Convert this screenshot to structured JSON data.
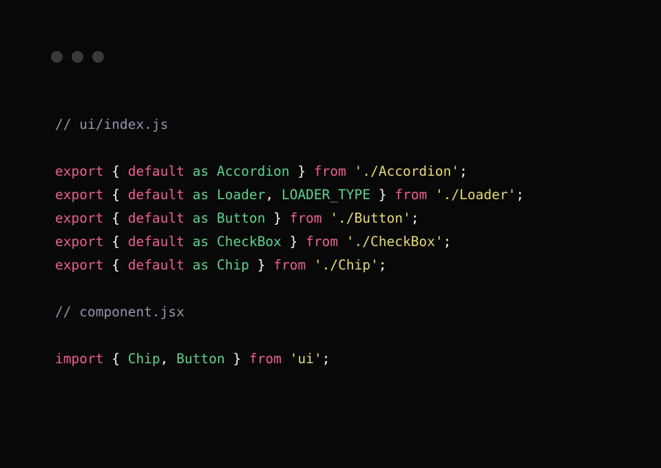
{
  "window": {
    "background_color": "#080808",
    "controls": [
      {
        "name": "window-dot-close",
        "color": "#3a3a3a"
      },
      {
        "name": "window-dot-minimize",
        "color": "#3a3a3a"
      },
      {
        "name": "window-dot-maximize",
        "color": "#3a3a3a"
      }
    ]
  },
  "theme": {
    "comment_color": "#9a92b0",
    "keyword_color": "#ef5f96",
    "identifier_color": "#5fd38d",
    "string_color": "#e6db74",
    "punctuation_color": "#f8f8f2"
  },
  "code": {
    "language": "javascript",
    "lines": [
      {
        "type": "comment",
        "text": "// ui/index.js"
      },
      {
        "type": "blank",
        "text": ""
      },
      {
        "type": "code",
        "tokens": [
          {
            "kind": "keyword",
            "text": "export"
          },
          {
            "kind": "plain",
            "text": " "
          },
          {
            "kind": "punct",
            "text": "{"
          },
          {
            "kind": "plain",
            "text": " "
          },
          {
            "kind": "keyword",
            "text": "default"
          },
          {
            "kind": "plain",
            "text": " "
          },
          {
            "kind": "name",
            "text": "as"
          },
          {
            "kind": "plain",
            "text": " "
          },
          {
            "kind": "name",
            "text": "Accordion"
          },
          {
            "kind": "plain",
            "text": " "
          },
          {
            "kind": "punct",
            "text": "}"
          },
          {
            "kind": "plain",
            "text": " "
          },
          {
            "kind": "keyword",
            "text": "from"
          },
          {
            "kind": "plain",
            "text": " "
          },
          {
            "kind": "string",
            "text": "'./Accordion'"
          },
          {
            "kind": "punct",
            "text": ";"
          }
        ]
      },
      {
        "type": "code",
        "tokens": [
          {
            "kind": "keyword",
            "text": "export"
          },
          {
            "kind": "plain",
            "text": " "
          },
          {
            "kind": "punct",
            "text": "{"
          },
          {
            "kind": "plain",
            "text": " "
          },
          {
            "kind": "keyword",
            "text": "default"
          },
          {
            "kind": "plain",
            "text": " "
          },
          {
            "kind": "name",
            "text": "as"
          },
          {
            "kind": "plain",
            "text": " "
          },
          {
            "kind": "name",
            "text": "Loader"
          },
          {
            "kind": "punct",
            "text": ","
          },
          {
            "kind": "plain",
            "text": " "
          },
          {
            "kind": "name",
            "text": "LOADER_TYPE"
          },
          {
            "kind": "plain",
            "text": " "
          },
          {
            "kind": "punct",
            "text": "}"
          },
          {
            "kind": "plain",
            "text": " "
          },
          {
            "kind": "keyword",
            "text": "from"
          },
          {
            "kind": "plain",
            "text": " "
          },
          {
            "kind": "string",
            "text": "'./Loader'"
          },
          {
            "kind": "punct",
            "text": ";"
          }
        ]
      },
      {
        "type": "code",
        "tokens": [
          {
            "kind": "keyword",
            "text": "export"
          },
          {
            "kind": "plain",
            "text": " "
          },
          {
            "kind": "punct",
            "text": "{"
          },
          {
            "kind": "plain",
            "text": " "
          },
          {
            "kind": "keyword",
            "text": "default"
          },
          {
            "kind": "plain",
            "text": " "
          },
          {
            "kind": "name",
            "text": "as"
          },
          {
            "kind": "plain",
            "text": " "
          },
          {
            "kind": "name",
            "text": "Button"
          },
          {
            "kind": "plain",
            "text": " "
          },
          {
            "kind": "punct",
            "text": "}"
          },
          {
            "kind": "plain",
            "text": " "
          },
          {
            "kind": "keyword",
            "text": "from"
          },
          {
            "kind": "plain",
            "text": " "
          },
          {
            "kind": "string",
            "text": "'./Button'"
          },
          {
            "kind": "punct",
            "text": ";"
          }
        ]
      },
      {
        "type": "code",
        "tokens": [
          {
            "kind": "keyword",
            "text": "export"
          },
          {
            "kind": "plain",
            "text": " "
          },
          {
            "kind": "punct",
            "text": "{"
          },
          {
            "kind": "plain",
            "text": " "
          },
          {
            "kind": "keyword",
            "text": "default"
          },
          {
            "kind": "plain",
            "text": " "
          },
          {
            "kind": "name",
            "text": "as"
          },
          {
            "kind": "plain",
            "text": " "
          },
          {
            "kind": "name",
            "text": "CheckBox"
          },
          {
            "kind": "plain",
            "text": " "
          },
          {
            "kind": "punct",
            "text": "}"
          },
          {
            "kind": "plain",
            "text": " "
          },
          {
            "kind": "keyword",
            "text": "from"
          },
          {
            "kind": "plain",
            "text": " "
          },
          {
            "kind": "string",
            "text": "'./CheckBox'"
          },
          {
            "kind": "punct",
            "text": ";"
          }
        ]
      },
      {
        "type": "code",
        "tokens": [
          {
            "kind": "keyword",
            "text": "export"
          },
          {
            "kind": "plain",
            "text": " "
          },
          {
            "kind": "punct",
            "text": "{"
          },
          {
            "kind": "plain",
            "text": " "
          },
          {
            "kind": "keyword",
            "text": "default"
          },
          {
            "kind": "plain",
            "text": " "
          },
          {
            "kind": "name",
            "text": "as"
          },
          {
            "kind": "plain",
            "text": " "
          },
          {
            "kind": "name",
            "text": "Chip"
          },
          {
            "kind": "plain",
            "text": " "
          },
          {
            "kind": "punct",
            "text": "}"
          },
          {
            "kind": "plain",
            "text": " "
          },
          {
            "kind": "keyword",
            "text": "from"
          },
          {
            "kind": "plain",
            "text": " "
          },
          {
            "kind": "string",
            "text": "'./Chip'"
          },
          {
            "kind": "punct",
            "text": ";"
          }
        ]
      },
      {
        "type": "blank",
        "text": ""
      },
      {
        "type": "comment",
        "text": "// component.jsx"
      },
      {
        "type": "blank",
        "text": ""
      },
      {
        "type": "code",
        "tokens": [
          {
            "kind": "keyword",
            "text": "import"
          },
          {
            "kind": "plain",
            "text": " "
          },
          {
            "kind": "punct",
            "text": "{"
          },
          {
            "kind": "plain",
            "text": " "
          },
          {
            "kind": "name",
            "text": "Chip"
          },
          {
            "kind": "punct",
            "text": ","
          },
          {
            "kind": "plain",
            "text": " "
          },
          {
            "kind": "name",
            "text": "Button"
          },
          {
            "kind": "plain",
            "text": " "
          },
          {
            "kind": "punct",
            "text": "}"
          },
          {
            "kind": "plain",
            "text": " "
          },
          {
            "kind": "keyword",
            "text": "from"
          },
          {
            "kind": "plain",
            "text": " "
          },
          {
            "kind": "string",
            "text": "'ui'"
          },
          {
            "kind": "punct",
            "text": ";"
          }
        ]
      }
    ]
  }
}
